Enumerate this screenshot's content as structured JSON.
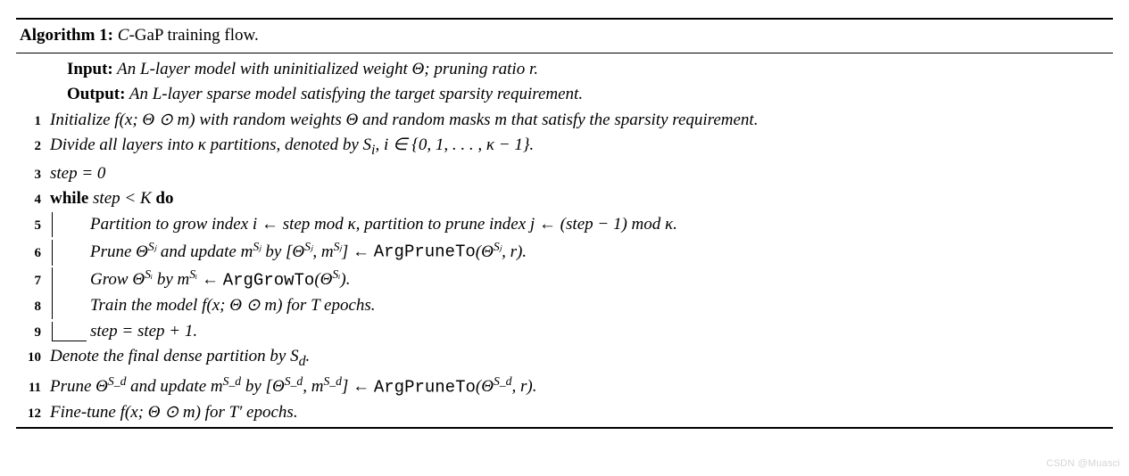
{
  "algorithm": {
    "number": "Algorithm 1:",
    "name_pre": "C",
    "name_post": "-GaP training flow.",
    "input_label": "Input:",
    "input_text": " An L-layer model with uninitialized weight Θ; pruning ratio r.",
    "output_label": "Output:",
    "output_text": " An L-layer sparse model satisfying the target sparsity requirement.",
    "lines": {
      "l1": "Initialize f(x; Θ ⊙ m) with random weights Θ and random masks m that satisfy the sparsity requirement.",
      "l2_a": "Divide all layers into κ partitions, denoted by S",
      "l2_sub": "i",
      "l2_b": ", i ∈ {0, 1, . . . , κ − 1}.",
      "l3_var": "step",
      "l3_rhs": " = 0",
      "l4_kw": "while",
      "l4_cond_a": " step",
      "l4_cond_b": " < K ",
      "l4_do": "do",
      "l5_a": "Partition to grow index i ← ",
      "l5_step": "step",
      "l5_b": " mod κ, partition to prune index j ← (",
      "l5_step2": "step",
      "l5_c": " − 1) mod κ.",
      "l6_a": "Prune Θ",
      "l6_sup1": "Sⱼ",
      "l6_b": " and update m",
      "l6_sup2": "Sⱼ",
      "l6_c": " by [Θ",
      "l6_sup3": "Sⱼ",
      "l6_d": ", m",
      "l6_sup4": "Sⱼ",
      "l6_e": "] ← ",
      "l6_fn": "ArgPruneTo",
      "l6_f": "(Θ",
      "l6_sup5": "Sⱼ",
      "l6_g": ", r).",
      "l7_a": "Grow Θ",
      "l7_sup1": "Sᵢ",
      "l7_b": " by m",
      "l7_sup2": "Sᵢ",
      "l7_c": " ← ",
      "l7_fn": "ArgGrowTo",
      "l7_d": "(Θ",
      "l7_sup3": "Sᵢ",
      "l7_e": ").",
      "l8": "Train the model f(x; Θ ⊙ m) for T epochs.",
      "l9_a": "step",
      "l9_b": " = ",
      "l9_c": "step",
      "l9_d": " + 1.",
      "l10_a": "Denote the final dense partition by S",
      "l10_sub": "d",
      "l10_b": ".",
      "l11_a": "Prune Θ",
      "l11_sup1": "S_d",
      "l11_b": " and update m",
      "l11_sup2": "S_d",
      "l11_c": " by [Θ",
      "l11_sup3": "S_d",
      "l11_d": ", m",
      "l11_sup4": "S_d",
      "l11_e": "] ← ",
      "l11_fn": "ArgPruneTo",
      "l11_f": "(Θ",
      "l11_sup5": "S_d",
      "l11_g": ", r).",
      "l12": "Fine-tune f(x; Θ ⊙ m) for T′ epochs."
    }
  },
  "watermark": "CSDN @Muasci"
}
